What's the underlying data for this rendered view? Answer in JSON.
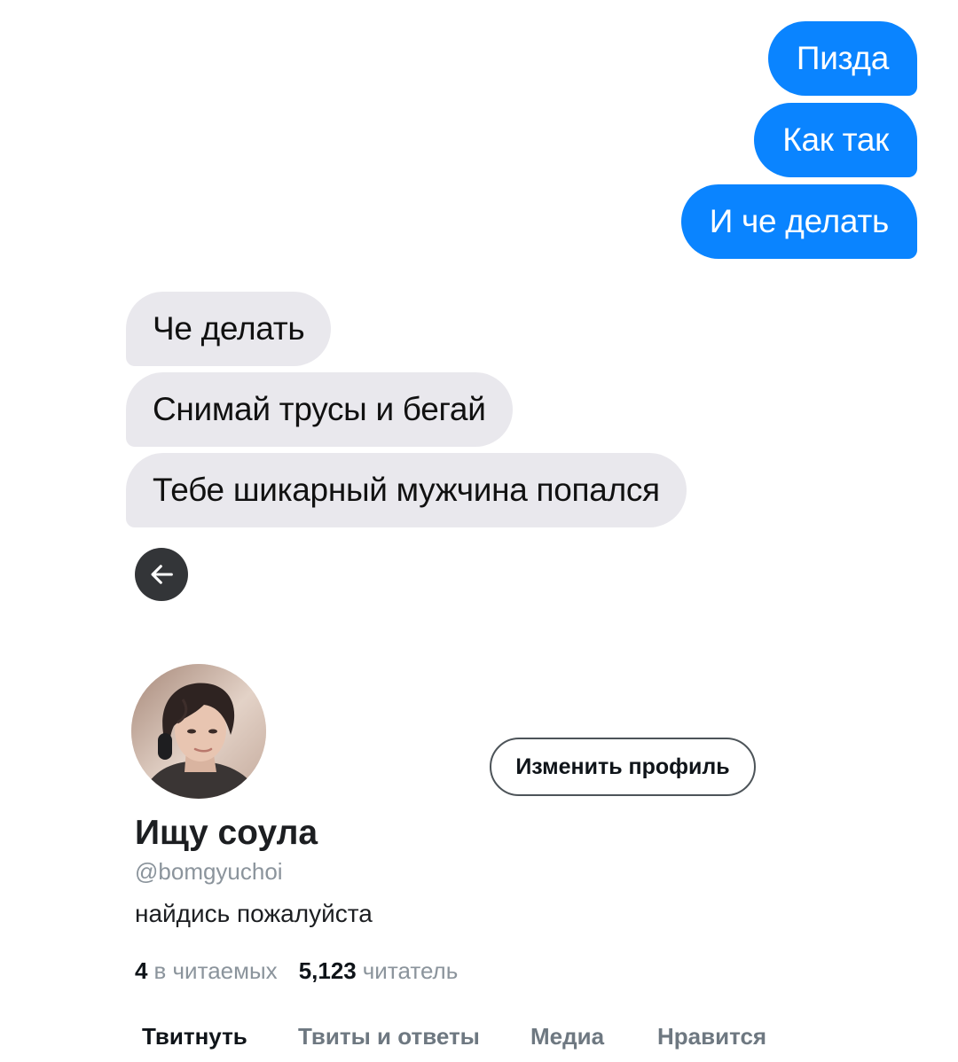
{
  "chat": {
    "outgoing": [
      {
        "text": "Пизда"
      },
      {
        "text": "Как так"
      },
      {
        "text": "И че делать"
      }
    ],
    "incoming": [
      {
        "text": "Че делать"
      },
      {
        "text": "Снимай трусы и бегай"
      },
      {
        "text": "Тебе шикарный мужчина попался"
      }
    ],
    "colors": {
      "outgoing_bubble": "#0a84ff",
      "incoming_bubble": "#e9e8ed"
    }
  },
  "back_button": {
    "icon": "arrow-left-icon"
  },
  "profile": {
    "avatar": "avatar-photo",
    "edit_button_label": "Изменить профиль",
    "display_name": "Ищу соула",
    "handle": "@bomgyuchoi",
    "bio": "найдись пожалуйста",
    "following": {
      "count": "4",
      "label": "в читаемых"
    },
    "followers": {
      "count": "5,123",
      "label": "читатель"
    }
  },
  "tabs": [
    {
      "label": "Твитнуть",
      "active": true
    },
    {
      "label": "Твиты и ответы",
      "active": false
    },
    {
      "label": "Медиа",
      "active": false
    },
    {
      "label": "Нравится",
      "active": false
    }
  ]
}
